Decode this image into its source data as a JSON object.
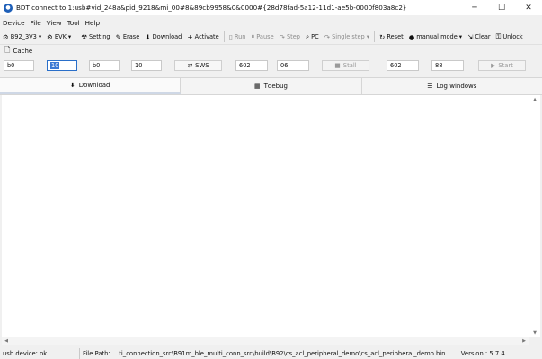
{
  "window": {
    "title": "BDT connect to 1:usb#vid_248a&pid_9218&mi_00#8&89cb9958&0&0000#{28d78fad-5a12-11d1-ae5b-0000f803a8c2}",
    "minimize": "─",
    "maximize": "☐",
    "close": "✕"
  },
  "menu": [
    "Device",
    "File",
    "View",
    "Tool",
    "Help"
  ],
  "toolbar": {
    "chip": "B92_3V3",
    "board": "EVK",
    "setting": "Setting",
    "erase": "Erase",
    "download": "Download",
    "activate": "Activate",
    "run": "Run",
    "pause": "Pause",
    "step": "Step",
    "pc": "PC",
    "single_step": "Single step",
    "reset": "Reset",
    "mode": "manual mode",
    "clear": "Clear",
    "unlock": "Unlock"
  },
  "cache": {
    "label": "Cache"
  },
  "fields": {
    "f1": "b0",
    "f2": "10",
    "f3": "b0",
    "f4": "10",
    "sws": "SWS",
    "f5": "602",
    "f6": "06",
    "stall": "Stall",
    "f7": "602",
    "f8": "88",
    "start": "Start"
  },
  "tabs": {
    "download": "Download",
    "tdebug": "Tdebug",
    "log": "Log windows"
  },
  "status": {
    "usb": "usb device: ok",
    "path_label": "File Path:",
    "path": "..  ti_connection_src\\B91m_ble_multi_conn_src\\build\\B92\\cs_acl_peripheral_demo\\cs_acl_peripheral_demo.bin",
    "version": "Version : 5.7.4"
  }
}
